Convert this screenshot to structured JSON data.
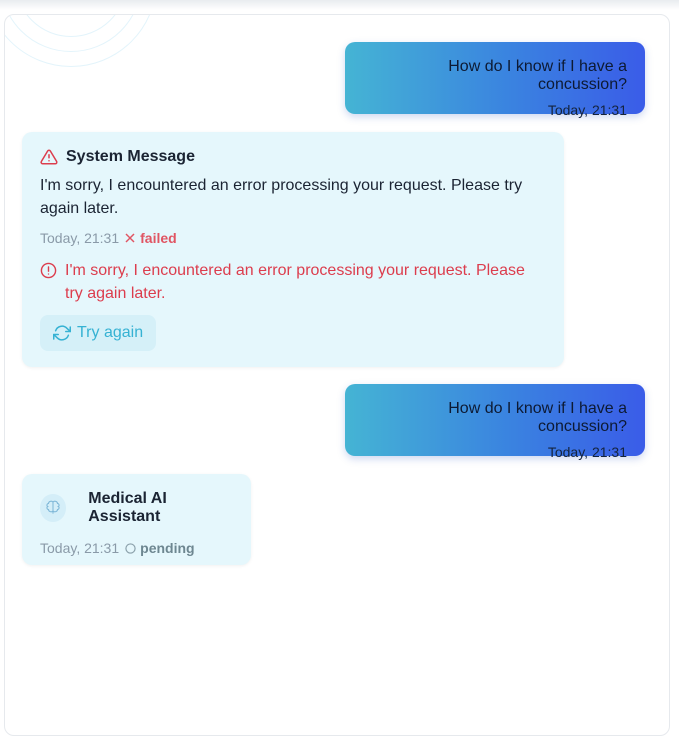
{
  "messages": {
    "user_1": {
      "text": "How do I know if I have a concussion?",
      "time": "Today, 21:31"
    },
    "system": {
      "title": "System Message",
      "body": "I'm sorry, I encountered an error processing your request. Please try again later.",
      "time": "Today, 21:31",
      "status": "failed",
      "error_text": "I'm sorry, I encountered an error processing your request. Please try again later.",
      "retry_label": "Try again"
    },
    "user_2": {
      "text": "How do I know if I have a concussion?",
      "time": "Today, 21:31"
    },
    "assistant": {
      "name": "Medical AI Assistant",
      "time": "Today, 21:31",
      "status": "pending"
    }
  },
  "icons": {
    "warning": "warning-triangle-icon",
    "failed": "x-icon",
    "error": "alert-circle-icon",
    "retry": "refresh-icon",
    "pending": "circle-icon",
    "avatar": "brain-icon"
  },
  "colors": {
    "user_gradient_start": "#45b4d4",
    "user_gradient_end": "#3a5ce8",
    "system_bg": "#e5f7fc",
    "error": "#dc3d4d",
    "accent": "#36b2d3"
  }
}
